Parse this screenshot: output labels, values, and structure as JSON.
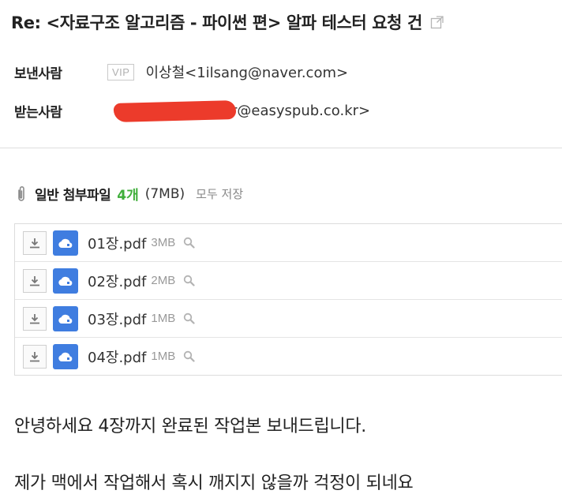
{
  "subject": "Re: <자료구조 알고리즘 - 파이썬 편> 알파 테스터 요청 건",
  "from": {
    "label": "보낸사람",
    "vip": "VIP",
    "sender": "이상철<1ilsang@naver.com>"
  },
  "to": {
    "label": "받는사람",
    "recipient_visible": "r@easyspub.co.kr>"
  },
  "attachments": {
    "title": "일반 첨부파일",
    "count": "4개",
    "total_size": "(7MB)",
    "save_all": "모두 저장",
    "files": [
      {
        "name": "01장.pdf",
        "size": "3MB"
      },
      {
        "name": "02장.pdf",
        "size": "2MB"
      },
      {
        "name": "03장.pdf",
        "size": "1MB"
      },
      {
        "name": "04장.pdf",
        "size": "1MB"
      }
    ]
  },
  "body": {
    "line1": "안녕하세요 4장까지 완료된 작업본 보내드립니다.",
    "line2": "제가 맥에서 작업해서 혹시 깨지지 않을까 걱정이 되네요"
  },
  "colors": {
    "accent_green": "#3fae3a",
    "cloud_blue": "#3f7de0",
    "redaction": "#ec3b2b"
  },
  "icons": [
    "popout-icon",
    "paperclip-icon",
    "download-icon",
    "cloud-save-icon",
    "search-icon"
  ]
}
